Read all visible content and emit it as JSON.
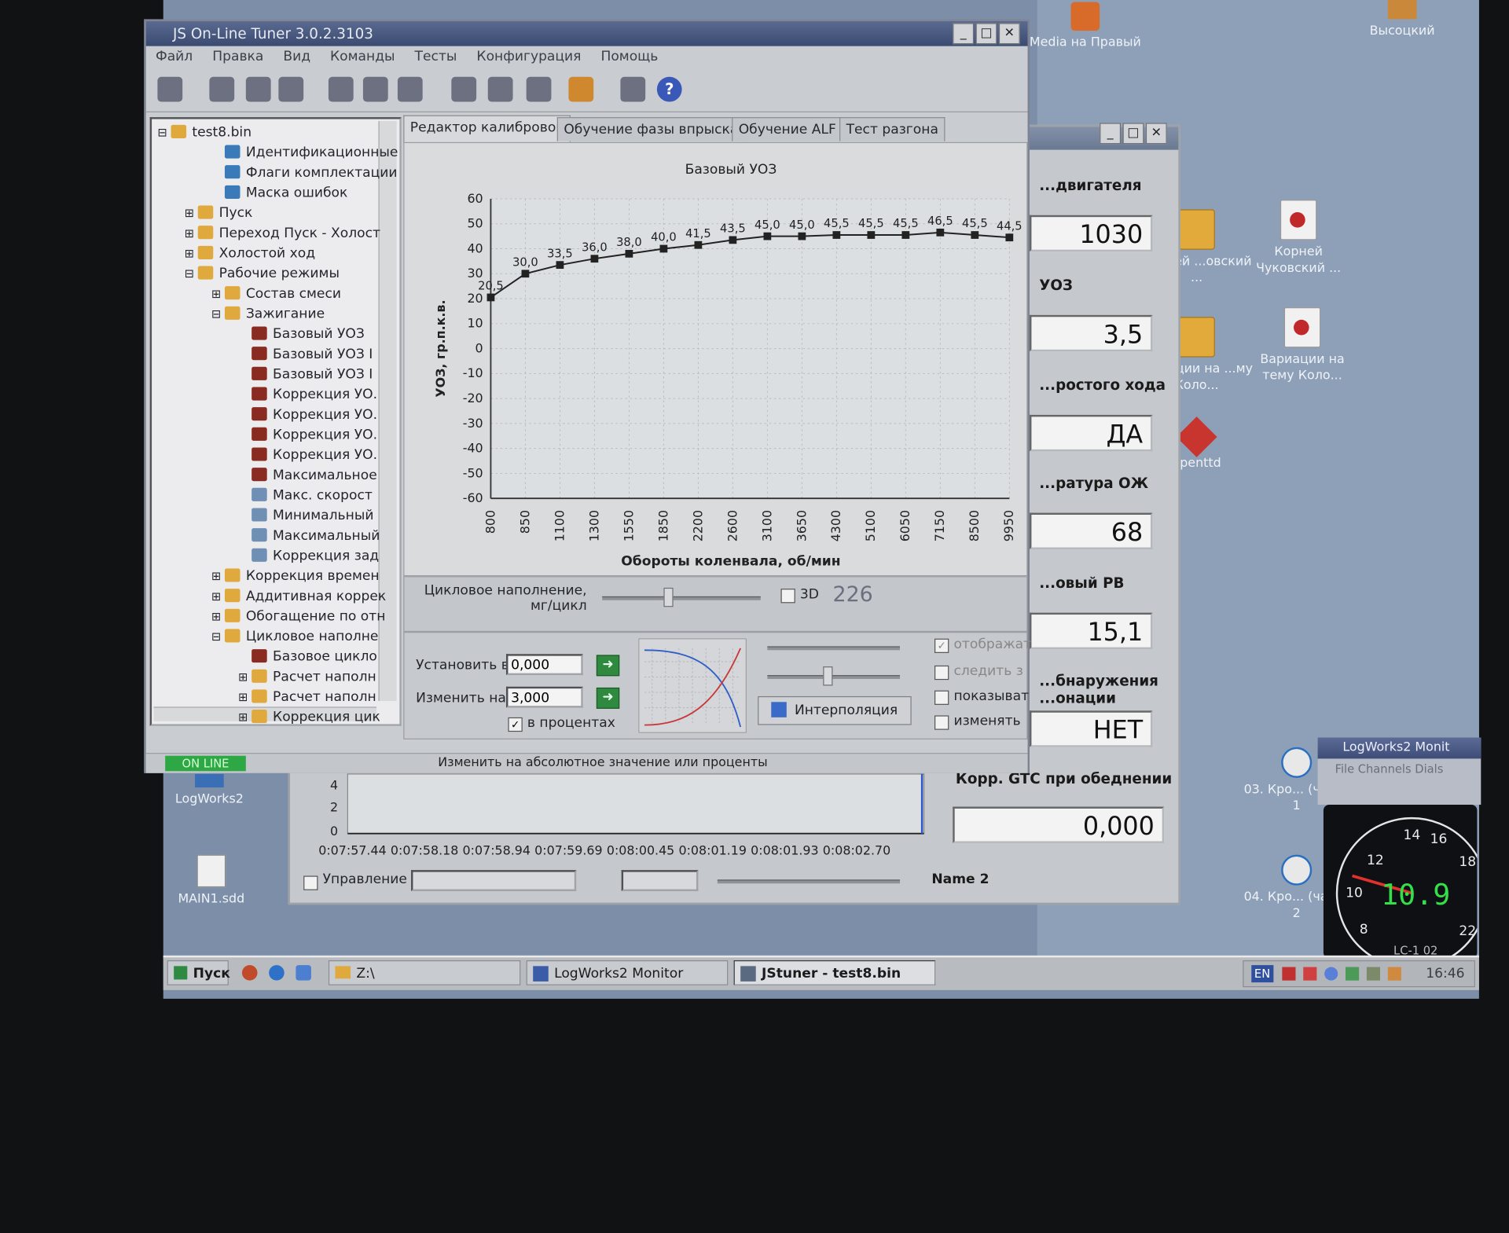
{
  "desktop": {
    "icons_top": [
      {
        "label": "Media на Правый"
      },
      {
        "label": "Высоцкий"
      }
    ],
    "icons_right": [
      {
        "label": "Корней ...овский ..."
      },
      {
        "label": "Корней Чуковский ..."
      },
      {
        "label": "...виации на ...му Коло..."
      },
      {
        "label": "Вариации на тему Коло..."
      },
      {
        "label": "openttd"
      },
      {
        "label": "03. Кро... (часть 1"
      },
      {
        "label": "04. Кро... (часть 2"
      }
    ],
    "icons_left": [
      {
        "label": "LogWorks2"
      },
      {
        "label": "MAIN1.sdd"
      }
    ]
  },
  "taskbar": {
    "start": "Пуск",
    "buttons": [
      {
        "label": "Z:\\"
      },
      {
        "label": "LogWorks2 Monitor"
      },
      {
        "label": "JStuner - test8.bin"
      }
    ],
    "lang": "EN",
    "clock": "16:46"
  },
  "logworks": {
    "panels": [
      {
        "label": "...двигателя",
        "value": "1030"
      },
      {
        "label": "УОЗ",
        "value": "3,5"
      },
      {
        "label": "...ростого хода",
        "value": "ДА"
      },
      {
        "label": "...ратура ОЖ",
        "value": "68"
      },
      {
        "label": "...овый РВ",
        "value": "15,1"
      },
      {
        "label": "...бнаружения ...онации",
        "value": "НЕТ"
      },
      {
        "label": "Корр. GTC при обеднении",
        "value": "0,000"
      }
    ],
    "bottom_chart": {
      "yticks": [
        "4",
        "2",
        "0"
      ],
      "xticks": [
        "0:07:57.44",
        "0:07:58.18",
        "0:07:58.94",
        "0:07:59.69",
        "0:08:00.45",
        "0:08:01.19",
        "0:08:01.93",
        "0:08:02.70"
      ]
    },
    "control_label": "Управление",
    "name_label": "Name 2",
    "monitor_title": "LogWorks2 Monit",
    "monitor_menu": "File  Channels  Dials",
    "gauge_value": "10.9",
    "gauge_ticks": [
      "8",
      "10",
      "12",
      "14",
      "16",
      "18",
      "22"
    ],
    "gauge_unit": "LC-1 02"
  },
  "window": {
    "title": "JS On-Line Tuner 3.0.2.3103",
    "menu": [
      "Файл",
      "Правка",
      "Вид",
      "Команды",
      "Тесты",
      "Конфигурация",
      "Помощь"
    ],
    "help_icon": "?",
    "tree": [
      {
        "label": "test8.bin",
        "indent": 0,
        "icon": "f",
        "toggle": "⊟"
      },
      {
        "label": "Идентификационные д",
        "indent": 2,
        "icon": "m",
        "toggle": ""
      },
      {
        "label": "Флаги комплектации",
        "indent": 2,
        "icon": "m",
        "toggle": ""
      },
      {
        "label": "Маска ошибок",
        "indent": 2,
        "icon": "m",
        "toggle": ""
      },
      {
        "label": "Пуск",
        "indent": 1,
        "icon": "f",
        "toggle": "⊞"
      },
      {
        "label": "Переход Пуск - Холост",
        "indent": 1,
        "icon": "f",
        "toggle": "⊞"
      },
      {
        "label": "Холостой ход",
        "indent": 1,
        "icon": "f",
        "toggle": "⊞"
      },
      {
        "label": "Рабочие режимы",
        "indent": 1,
        "icon": "f",
        "toggle": "⊟"
      },
      {
        "label": "Состав смеси",
        "indent": 2,
        "icon": "f",
        "toggle": "⊞"
      },
      {
        "label": "Зажигание",
        "indent": 2,
        "icon": "f",
        "toggle": "⊟"
      },
      {
        "label": "Базовый УОЗ",
        "indent": 3,
        "icon": "r",
        "toggle": ""
      },
      {
        "label": "Базовый УОЗ I",
        "indent": 3,
        "icon": "r",
        "toggle": ""
      },
      {
        "label": "Базовый УОЗ I",
        "indent": 3,
        "icon": "r",
        "toggle": ""
      },
      {
        "label": "Коррекция УО.",
        "indent": 3,
        "icon": "r",
        "toggle": ""
      },
      {
        "label": "Коррекция УО.",
        "indent": 3,
        "icon": "r",
        "toggle": ""
      },
      {
        "label": "Коррекция УО.",
        "indent": 3,
        "icon": "r",
        "toggle": ""
      },
      {
        "label": "Коррекция УО.",
        "indent": 3,
        "icon": "r",
        "toggle": ""
      },
      {
        "label": "Максимальное",
        "indent": 3,
        "icon": "r",
        "toggle": ""
      },
      {
        "label": "Макс. скорост",
        "indent": 3,
        "icon": "t",
        "toggle": ""
      },
      {
        "label": "Минимальный",
        "indent": 3,
        "icon": "t",
        "toggle": ""
      },
      {
        "label": "Максимальный",
        "indent": 3,
        "icon": "t",
        "toggle": ""
      },
      {
        "label": "Коррекция зад",
        "indent": 3,
        "icon": "t",
        "toggle": ""
      },
      {
        "label": "Коррекция времен",
        "indent": 2,
        "icon": "f",
        "toggle": "⊞"
      },
      {
        "label": "Аддитивная коррек",
        "indent": 2,
        "icon": "f",
        "toggle": "⊞"
      },
      {
        "label": "Обогащение по отн",
        "indent": 2,
        "icon": "f",
        "toggle": "⊞"
      },
      {
        "label": "Цикловое наполне",
        "indent": 2,
        "icon": "f",
        "toggle": "⊟"
      },
      {
        "label": "Базовое цикло",
        "indent": 3,
        "icon": "r",
        "toggle": ""
      },
      {
        "label": "Расчет наполн",
        "indent": 3,
        "icon": "f",
        "toggle": "⊞"
      },
      {
        "label": "Расчет наполн",
        "indent": 3,
        "icon": "f",
        "toggle": "⊞"
      },
      {
        "label": "Коррекция цик",
        "indent": 3,
        "icon": "f",
        "toggle": "⊞"
      }
    ],
    "tabs": [
      "Редактор калибровок",
      "Обучение фазы впрыска",
      "Обучение ALF",
      "Тест разгона"
    ],
    "controls": {
      "cycle_fill_label": "Цикловое наполнение, мг/цикл",
      "three_d": "3D",
      "cycle_value": "226",
      "set_label": "Установить в",
      "set_value": "0,000",
      "change_label": "Изменить на",
      "change_value": "3,000",
      "percent_label": "в процентах",
      "interp_button": "Интерполяция",
      "opt_display": "отображат",
      "opt_follow": "следить з",
      "opt_show": "показыват",
      "opt_change": "изменять"
    },
    "status_online": "ON LINE",
    "status_text": "Изменить на абсолютное значение или проценты"
  },
  "chart_data": {
    "type": "line",
    "title": "Базовый УОЗ",
    "xlabel": "Обороты коленвала, об/мин",
    "ylabel": "УОЗ, гр.п.к.в.",
    "ylim": [
      -60,
      60
    ],
    "yticks": [
      60,
      50,
      40,
      30,
      20,
      10,
      0,
      -10,
      -20,
      -30,
      -40,
      -50,
      -60
    ],
    "categories": [
      "800",
      "850",
      "1100",
      "1300",
      "1550",
      "1850",
      "2200",
      "2600",
      "3100",
      "3650",
      "4300",
      "5100",
      "6050",
      "7150",
      "8500",
      "9950"
    ],
    "values": [
      20.5,
      30.0,
      33.5,
      36.0,
      38.0,
      40.0,
      41.5,
      43.5,
      45.0,
      45.0,
      45.5,
      45.5,
      45.5,
      46.5,
      45.5,
      44.5
    ],
    "data_labels": [
      "20,5",
      "30,0",
      "33,5",
      "36,0",
      "38,0",
      "40,0",
      "41,5",
      "43,5",
      "45,0",
      "45,0",
      "45,5",
      "45,5",
      "45,5",
      "46,5",
      "45,5",
      "44,5"
    ],
    "grid": true,
    "color": "#222222"
  }
}
